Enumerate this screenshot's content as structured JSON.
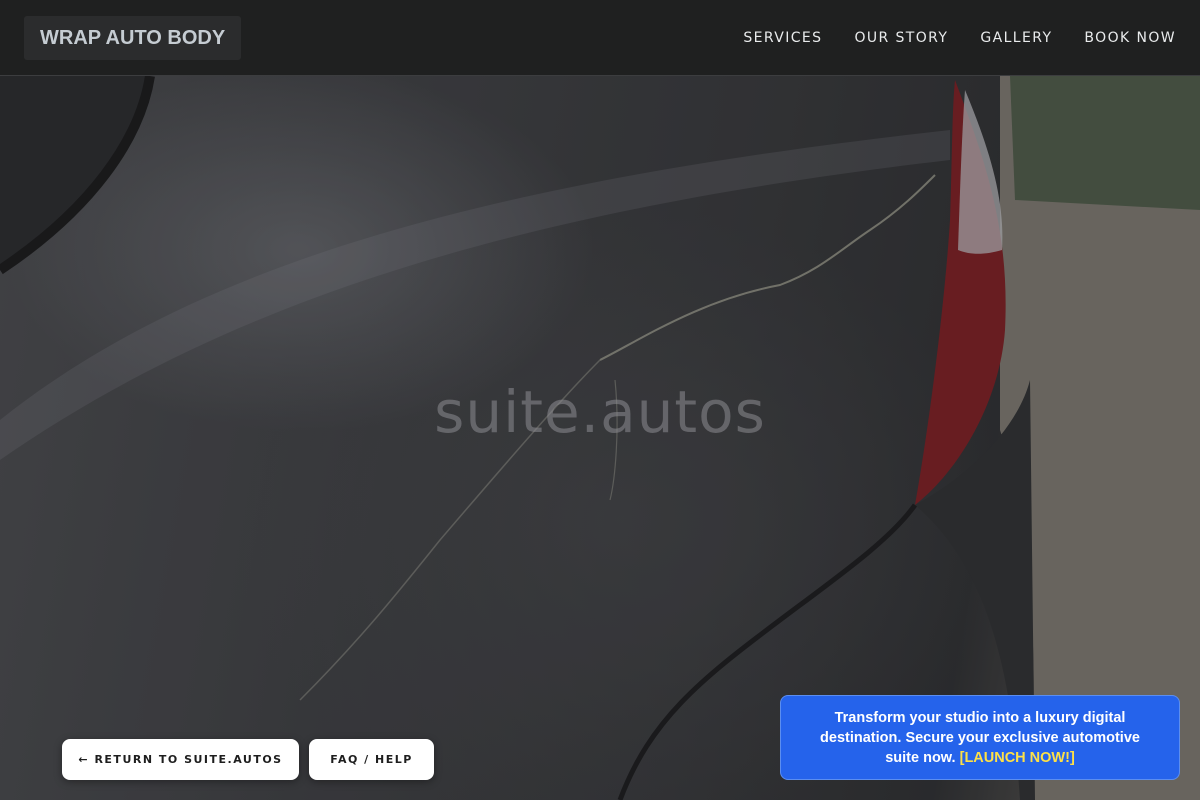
{
  "header": {
    "brand": "WRAP AUTO BODY",
    "nav": [
      {
        "label": "SERVICES"
      },
      {
        "label": "OUR STORY"
      },
      {
        "label": "GALLERY"
      },
      {
        "label": "BOOK NOW"
      }
    ]
  },
  "hero": {
    "watermark": "suite.autos"
  },
  "buttons": {
    "return_label": "← RETURN TO SUITE.AUTOS",
    "faq_label": "FAQ / HELP"
  },
  "promo": {
    "text": "Transform your studio into a luxury digital destination. Secure your exclusive automotive suite now.",
    "cta": "[LAUNCH NOW!]"
  },
  "colors": {
    "header_bg": "#1f2020",
    "promo_bg": "#2563eb",
    "promo_cta": "#fde047"
  }
}
